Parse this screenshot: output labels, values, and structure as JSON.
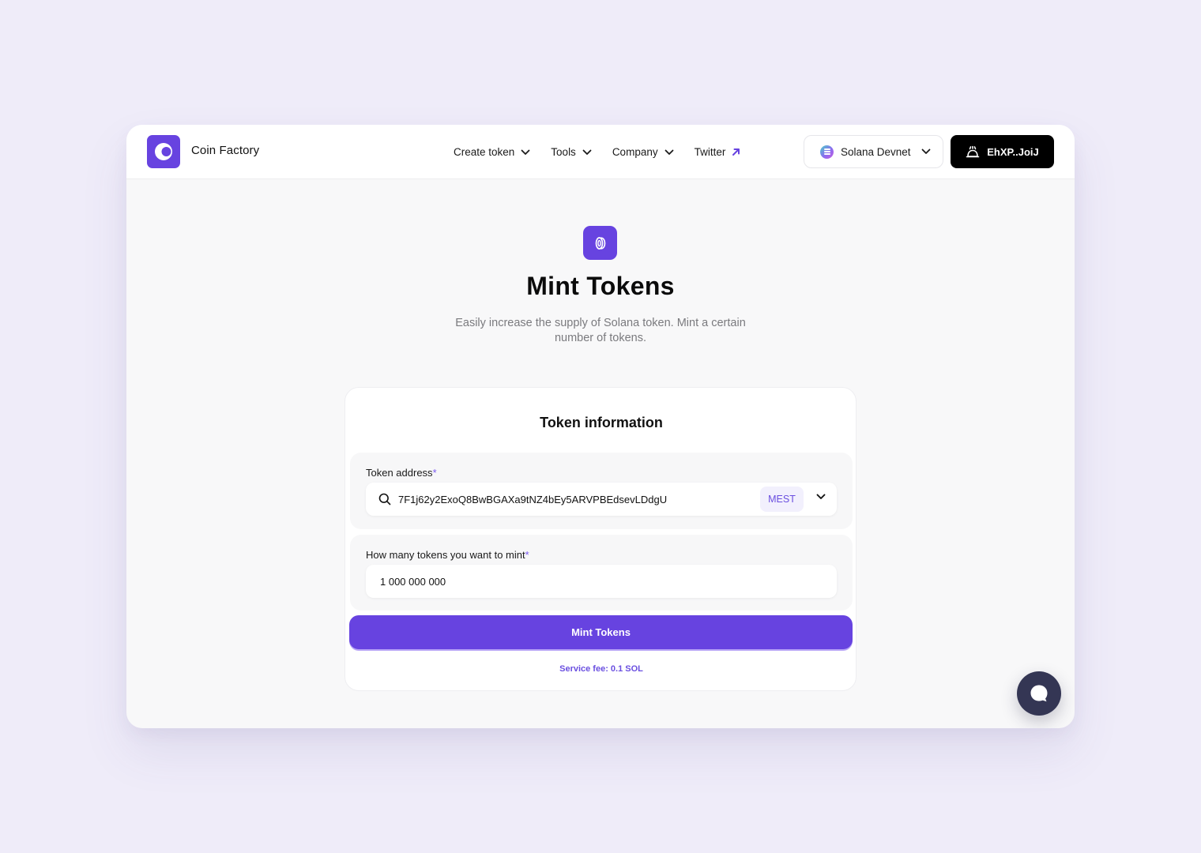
{
  "header": {
    "brand_name": "Coin Factory",
    "logo_icon": "coin-factory-logo-icon",
    "nav": [
      {
        "label": "Create token",
        "icon": "chevron-down-icon"
      },
      {
        "label": "Tools",
        "icon": "chevron-down-icon"
      },
      {
        "label": "Company",
        "icon": "chevron-down-icon"
      },
      {
        "label": "Twitter",
        "icon": "external-arrow-icon"
      }
    ],
    "network": {
      "label": "Solana Devnet",
      "icon": "solana-icon"
    },
    "wallet": {
      "label": "EhXP..JoiJ",
      "icon": "wallet-icon"
    }
  },
  "page": {
    "hero_icon": "coin-icon",
    "title": "Mint Tokens",
    "subtitle": "Easily increase the supply of Solana token. Mint a certain number of tokens."
  },
  "form": {
    "title": "Token information",
    "token_address": {
      "label": "Token address",
      "required_mark": "*",
      "value": "7F1j62y2ExoQ8BwBGAXa9tNZ4bEy5ARVPBEdsevLDdgU",
      "ticker": "MEST"
    },
    "amount": {
      "label": "How many tokens you want to mint",
      "required_mark": "*",
      "value": "1 000 000 000"
    },
    "submit_label": "Mint Tokens",
    "service_fee": "Service fee: 0.1 SOL"
  },
  "chat": {
    "icon": "chat-bubble-icon"
  },
  "colors": {
    "accent": "#6743e0",
    "background": "#efecf9",
    "chat_button": "#343654"
  }
}
